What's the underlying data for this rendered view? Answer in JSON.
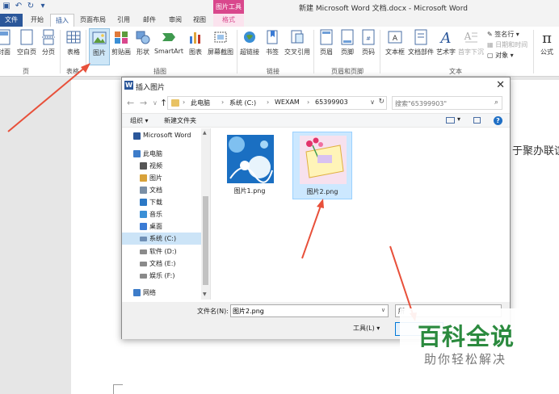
{
  "window": {
    "title": "新建 Microsoft Word 文档.docx - Microsoft Word",
    "context_tool_label": "图片工具"
  },
  "tabs": [
    "文件",
    "开始",
    "插入",
    "页面布局",
    "引用",
    "邮件",
    "审阅",
    "视图",
    "格式"
  ],
  "ribbon": {
    "buttons": {
      "cover": "封面",
      "blank_page": "空白页",
      "page_break": "分页",
      "table": "表格",
      "picture": "图片",
      "clipart": "剪贴画",
      "shapes": "形状",
      "smartart": "SmartArt",
      "chart": "图表",
      "screenshot": "屏幕截图",
      "hyperlink": "超链接",
      "bookmark": "书签",
      "cross_ref": "交叉引用",
      "header": "页眉",
      "footer": "页脚",
      "page_number": "页码",
      "textbox": "文本框",
      "quick_parts": "文档部件",
      "wordart": "艺术字",
      "dropcap": "首字下沉",
      "signature_line": "签名行",
      "date_time": "日期和时间",
      "object": "对象",
      "equation": "公式"
    },
    "groups": {
      "pages": "页",
      "tables": "表格",
      "illustrations": "插图",
      "links": "链接",
      "header_footer": "页眉和页脚",
      "text": "文本"
    }
  },
  "document": {
    "visible_text": "于聚办联谊"
  },
  "dialog": {
    "title": "插入图片",
    "breadcrumbs": [
      "此电脑",
      "系统 (C:)",
      "WEXAM",
      "65399903"
    ],
    "search_placeholder": "搜索\"65399903\"",
    "toolbar": {
      "organize": "组织 ▾",
      "new_folder": "新建文件夹"
    },
    "nav_items": [
      {
        "label": "Microsoft Word",
        "icon": "word-icon",
        "color": "#2b579a"
      },
      {
        "label": "此电脑",
        "icon": "computer-icon",
        "color": "#3d7cc9"
      },
      {
        "label": "视频",
        "icon": "video-icon",
        "color": "#555555"
      },
      {
        "label": "图片",
        "icon": "pictures-icon",
        "color": "#d8a23a"
      },
      {
        "label": "文档",
        "icon": "documents-icon",
        "color": "#7a8fa6"
      },
      {
        "label": "下载",
        "icon": "download-icon",
        "color": "#2b78c5"
      },
      {
        "label": "音乐",
        "icon": "music-icon",
        "color": "#3a8fd6"
      },
      {
        "label": "桌面",
        "icon": "desktop-icon",
        "color": "#3a7bd5"
      },
      {
        "label": "系统 (C:)",
        "icon": "drive-icon",
        "color": "#6f8fb5"
      },
      {
        "label": "软件 (D:)",
        "icon": "drive-icon",
        "color": "#8a8a8a"
      },
      {
        "label": "文档 (E:)",
        "icon": "drive-icon",
        "color": "#8a8a8a"
      },
      {
        "label": "娱乐 (F:)",
        "icon": "drive-icon",
        "color": "#8a8a8a"
      },
      {
        "label": "网络",
        "icon": "network-icon",
        "color": "#3d7cc9"
      }
    ],
    "selected_nav": "系统 (C:)",
    "files": [
      {
        "name": "图片1.png",
        "selected": false
      },
      {
        "name": "图片2.png",
        "selected": true
      }
    ],
    "filename_label": "文件名(N):",
    "filename_value": "图片2.png",
    "filetype_value": "所",
    "tools_label": "工具(L)",
    "insert_label": ""
  },
  "watermark": {
    "main": "百科全说",
    "sub": "助你轻松解决"
  },
  "colors": {
    "accent": "#2b579a",
    "format_tab": "#d9478c",
    "selection": "#cce8ff",
    "arrow": "#e8503a"
  }
}
